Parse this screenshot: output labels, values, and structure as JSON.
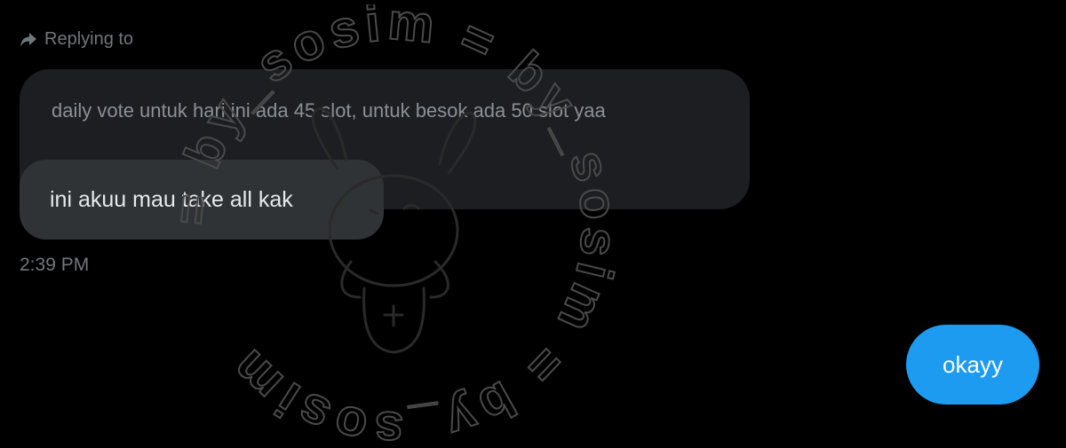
{
  "reply_header": {
    "label": "Replying to"
  },
  "quoted_message": {
    "text": "daily vote untuk hari ini ada 45 slot, untuk besok ada 50 slot yaa"
  },
  "incoming_message": {
    "text": "ini akuu mau take all kak"
  },
  "timestamp": "2:39 PM",
  "outgoing_message": {
    "text": "okayy"
  },
  "watermark": {
    "text": "= by_sosim = by_sosim = by_sosim"
  },
  "colors": {
    "background": "#000000",
    "quoted_bubble": "#1c1e21",
    "incoming_bubble": "#2f3336",
    "outgoing_bubble": "#1d9bf0",
    "muted_text": "#71767b"
  }
}
